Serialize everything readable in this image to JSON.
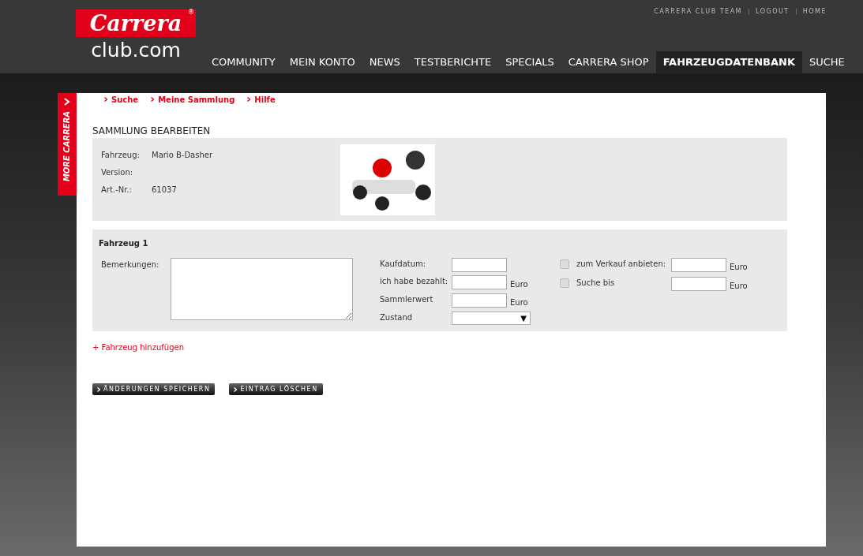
{
  "logo": {
    "brand": "Carrera",
    "mark": "®",
    "site": "club.com"
  },
  "top_links": [
    "CARRERA CLUB TEAM",
    "LOGOUT",
    "HOME"
  ],
  "nav": [
    {
      "label": "COMMUNITY",
      "selected": false
    },
    {
      "label": "MEIN KONTO",
      "selected": false
    },
    {
      "label": "NEWS",
      "selected": false
    },
    {
      "label": "TESTBERICHTE",
      "selected": false
    },
    {
      "label": "SPECIALS",
      "selected": false
    },
    {
      "label": "CARRERA SHOP",
      "selected": false
    },
    {
      "label": "FAHRZEUGDATENBANK",
      "selected": true
    },
    {
      "label": "SUCHE",
      "selected": false
    }
  ],
  "side_tab": "MORE CARRERA",
  "subnav": [
    "Suche",
    "Meine Sammlung",
    "Hilfe"
  ],
  "heading": "SAMMLUNG BEARBEITEN",
  "info": [
    {
      "label": "Fahrzeug:",
      "value": "Mario B-Dasher"
    },
    {
      "label": "Version:"
    },
    {
      "label": "Art.-Nr.:",
      "value": "61037"
    }
  ],
  "vehicle": {
    "title": "Fahrzeug 1",
    "remarks_label": "Bemerkungen:",
    "fields": [
      {
        "label": "Kaufdatum:"
      },
      {
        "label": "ich habe bezahlt:",
        "unit": "Euro"
      },
      {
        "label": "Sammlerwert",
        "unit": "Euro"
      }
    ],
    "condition": {
      "label": "Zustand",
      "arrow": "▼"
    },
    "offers": [
      {
        "label": "zum Verkauf anbieten:",
        "checked": false,
        "unit": "Euro"
      },
      {
        "label": "Suche bis",
        "checked": false,
        "unit": "Euro"
      }
    ]
  },
  "add_link": "+ Fahrzeug hinzufügen",
  "buttons": [
    "ÄNDERUNGEN SPEICHERN",
    "EINTRAG LÖSCHEN"
  ]
}
